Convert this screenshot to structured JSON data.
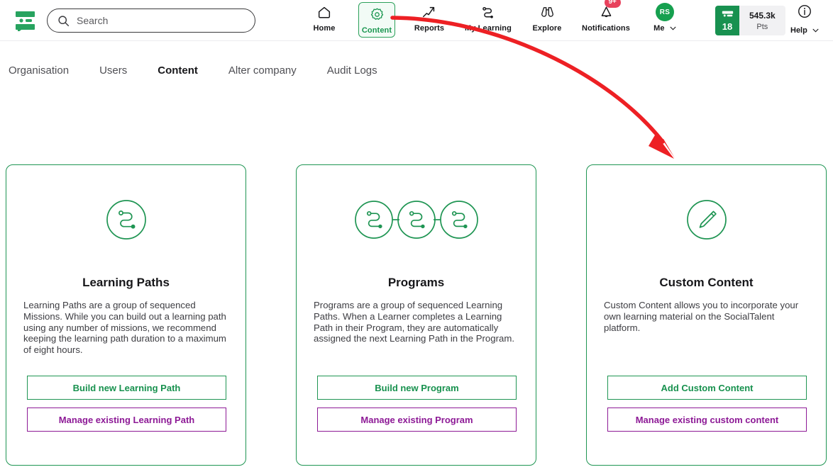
{
  "header": {
    "logo_icon": "socialtalent-logo-icon",
    "search": {
      "icon": "search-icon",
      "value": "",
      "placeholder": "Search"
    },
    "nav": [
      {
        "label": "Home",
        "icon": "home-icon",
        "active": false
      },
      {
        "label": "Content",
        "icon": "gear-icon",
        "active": true
      },
      {
        "label": "Reports",
        "icon": "trending-up-icon",
        "active": false
      },
      {
        "label": "My Learning",
        "icon": "path-icon",
        "active": false
      },
      {
        "label": "Explore",
        "icon": "binoculars-icon",
        "active": false
      },
      {
        "label": "Notifications",
        "icon": "bell-icon",
        "active": false
      },
      {
        "label": "Me",
        "icon": "avatar-icon",
        "active": false
      }
    ],
    "notifications_badge": "9+",
    "avatar_initials": "RS",
    "points": {
      "level": "18",
      "level_icon": "rank-card-icon",
      "value": "545.3k",
      "unit": "Pts"
    },
    "help": {
      "label": "Help",
      "icon": "info-icon"
    }
  },
  "tabs": [
    {
      "label": "Organisation",
      "active": false
    },
    {
      "label": "Users",
      "active": false
    },
    {
      "label": "Content",
      "active": true
    },
    {
      "label": "Alter company",
      "active": false
    },
    {
      "label": "Audit Logs",
      "active": false
    }
  ],
  "cards": [
    {
      "icon": "learning-path-icon",
      "title": "Learning Paths",
      "description": "Learning Paths are a group of sequenced Missions. While you can build out a learning path using any number of missions, we recommend keeping the learning path duration to a maximum of eight hours.",
      "primary_button": "Build new Learning Path",
      "secondary_button": "Manage existing Learning Path"
    },
    {
      "icon": "program-icon",
      "title": "Programs",
      "description": "Programs are a group of sequenced Learning Paths. When a Learner completes a Learning Path in their Program, they are automatically assigned the next Learning Path in the Program.",
      "primary_button": "Build new Program",
      "secondary_button": "Manage existing Program"
    },
    {
      "icon": "pencil-icon",
      "title": "Custom Content",
      "description": "Custom Content allows you to incorporate your own learning material on the SocialTalent platform.",
      "primary_button": "Add Custom Content",
      "secondary_button": "Manage existing custom content"
    }
  ],
  "annotation": {
    "arrow_icon": "red-curved-arrow-annotation",
    "color": "#ED2024",
    "from": "content-nav-item",
    "to": "custom-content-card"
  },
  "colors": {
    "brand_green": "#1f9553",
    "accent_purple": "#8d1a96",
    "annotation_red": "#ED2024",
    "badge_red": "#e8415c",
    "text_dark": "#17171a"
  }
}
